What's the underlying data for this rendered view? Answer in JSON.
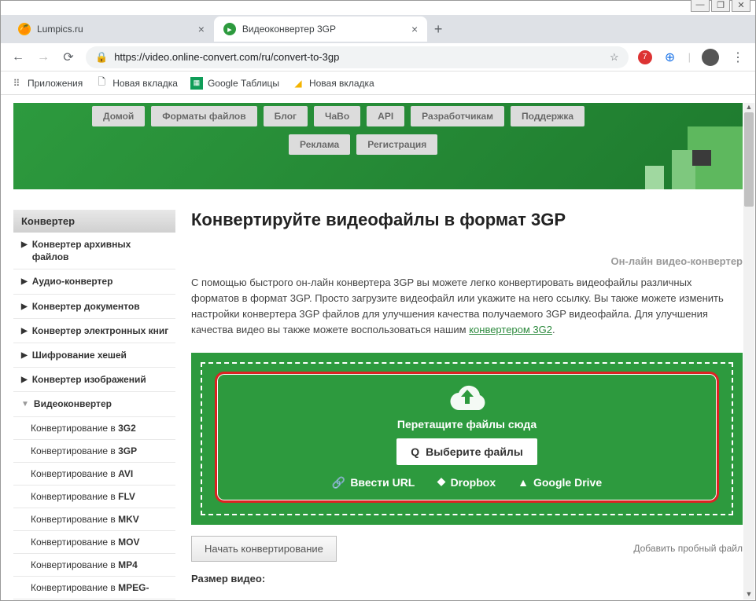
{
  "window": {
    "minimize": "—",
    "maximize": "❐",
    "close": "✕"
  },
  "tabs": [
    {
      "title": "Lumpics.ru",
      "active": false
    },
    {
      "title": "Видеоконвертер 3GP",
      "active": true
    }
  ],
  "nav": {
    "back": "←",
    "forward": "→",
    "reload": "⟳"
  },
  "address": {
    "url": "https://video.online-convert.com/ru/convert-to-3gp"
  },
  "bookmarks": {
    "apps": "Приложения",
    "items": [
      "Новая вкладка",
      "Google Таблицы",
      "Новая вкладка"
    ]
  },
  "topnav": {
    "row1": [
      "Домой",
      "Форматы файлов",
      "Блог",
      "ЧаВо",
      "API",
      "Разработчикам",
      "Поддержка"
    ],
    "row2": [
      "Реклама",
      "Регистрация"
    ]
  },
  "sidebar": {
    "header": "Конвертер",
    "items": [
      {
        "label": "Конвертер архивных файлов"
      },
      {
        "label": "Аудио-конвертер"
      },
      {
        "label": "Конвертер документов"
      },
      {
        "label": "Конвертер электронных книг"
      },
      {
        "label": "Шифрование хешей"
      },
      {
        "label": "Конвертер изображений"
      },
      {
        "label": "Видеоконвертер",
        "expanded": true
      }
    ],
    "subitems": [
      {
        "prefix": "Конвертирование в ",
        "fmt": "3G2"
      },
      {
        "prefix": "Конвертирование в ",
        "fmt": "3GP"
      },
      {
        "prefix": "Конвертирование в ",
        "fmt": "AVI"
      },
      {
        "prefix": "Конвертирование в ",
        "fmt": "FLV"
      },
      {
        "prefix": "Конвертирование в ",
        "fmt": "MKV"
      },
      {
        "prefix": "Конвертирование в ",
        "fmt": "MOV"
      },
      {
        "prefix": "Конвертирование в ",
        "fmt": "MP4"
      },
      {
        "prefix": "Конвертирование в ",
        "fmt": "MPEG-"
      }
    ]
  },
  "page": {
    "h1": "Конвертируйте видеофайлы в формат 3GP",
    "subtitle": "Он-лайн видео-конвертер",
    "desc_a": "С помощью быстрого он-лайн конвертера 3GP вы можете легко конвертировать видеофайлы различных форматов в формат 3GP. Просто загрузите видеофайл или укажите на него ссылку. Вы также можете изменить настройки конвертера 3GP файлов для улучшения качества получаемого 3GP видеофайла. Для улучшения качества видео вы также можете воспользоваться нашим ",
    "desc_link": "конвертером 3G2",
    "desc_b": ".",
    "drop_label": "Перетащите файлы сюда",
    "choose": "Выберите файлы",
    "src_url": "Ввести URL",
    "src_dropbox": "Dropbox",
    "src_gdrive": "Google Drive",
    "start": "Начать конвертирование",
    "add_trial": "Добавить пробный файл",
    "size_head": "Размер видео:"
  }
}
